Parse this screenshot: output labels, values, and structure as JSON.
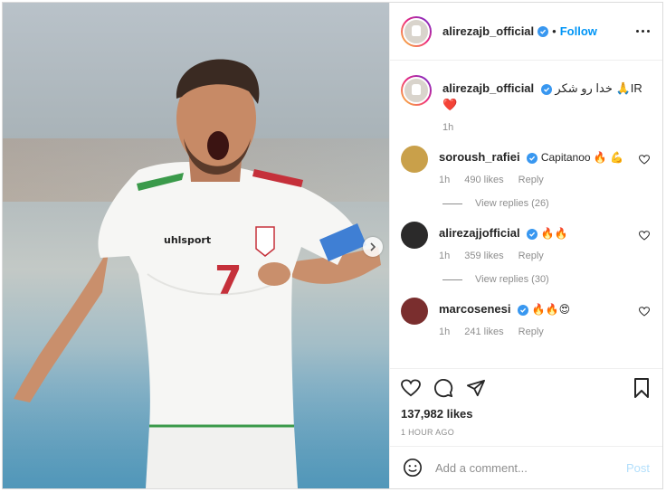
{
  "post": {
    "username": "alirezajb_official",
    "follow_label": "Follow",
    "caption": "خدا رو شکر 🙏IR❤️",
    "caption_time": "1h",
    "likes": "137,982 likes",
    "posted_ago": "1 HOUR AGO"
  },
  "comments": [
    {
      "username": "soroush_rafiei",
      "text": "Capitanoo 🔥 💪",
      "time": "1h",
      "likes": "490 likes",
      "reply": "Reply",
      "view_replies": "View replies (26)"
    },
    {
      "username": "alirezajjofficial",
      "text": "🔥🔥",
      "time": "1h",
      "likes": "359 likes",
      "reply": "Reply",
      "view_replies": "View replies (30)"
    },
    {
      "username": "marcosenesi",
      "text": "🔥🔥😍",
      "time": "1h",
      "likes": "241 likes",
      "reply": "Reply"
    }
  ],
  "comment_box": {
    "placeholder": "Add a comment...",
    "post_label": "Post"
  },
  "photo": {
    "shirt_text": "uhlsport",
    "shirt_number": "7"
  },
  "colors": {
    "accent": "#0095f6",
    "verified": "#3897f0",
    "muted": "#8e8e8e"
  }
}
